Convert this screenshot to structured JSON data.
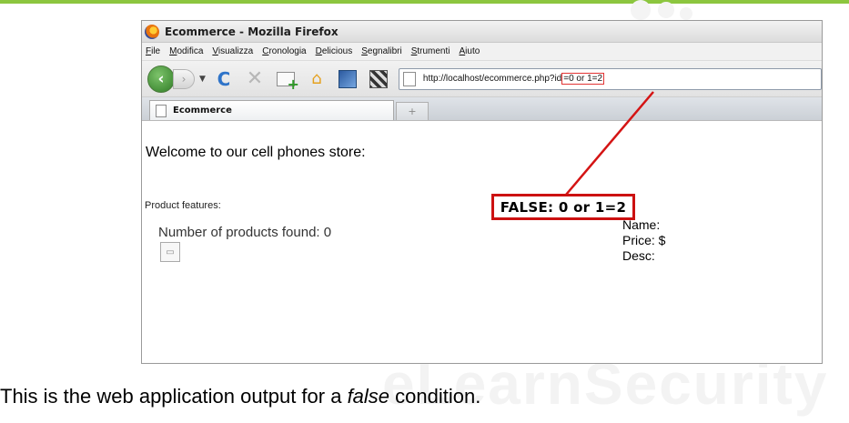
{
  "browser": {
    "title": "Ecommerce - Mozilla Firefox",
    "menu": [
      {
        "mnemonic": "F",
        "rest": "ile"
      },
      {
        "mnemonic": "M",
        "rest": "odifica"
      },
      {
        "mnemonic": "V",
        "rest": "isualizza"
      },
      {
        "mnemonic": "C",
        "rest": "ronologia"
      },
      {
        "mnemonic": "D",
        "rest": "elicious"
      },
      {
        "mnemonic": "S",
        "rest": "egnalibri"
      },
      {
        "mnemonic": "S",
        "rest": "trumenti"
      },
      {
        "mnemonic": "A",
        "rest": "iuto"
      }
    ],
    "url_prefix": "http://localhost/ecommerce.php?id",
    "url_payload": "=0 or 1=2",
    "tab_label": "Ecommerce",
    "new_tab_glyph": "+"
  },
  "page": {
    "welcome": "Welcome to our cell phones store:",
    "features_label": "Product features:",
    "products_found": "Number of products found: 0",
    "name_label": "Name:",
    "price_label": "Price: $",
    "desc_label": "Desc:"
  },
  "annotation": {
    "callout": "FALSE: 0 or 1=2",
    "color": "#cc1111"
  },
  "slide": {
    "caption_before": "This is the web application output for a ",
    "caption_emphasis": "false",
    "caption_after": " condition.",
    "watermark": "eLearnSecurity",
    "accent": "#8cc63f"
  },
  "icons": [
    "firefox-logo",
    "back-arrow-icon",
    "forward-arrow-icon",
    "reload-icon",
    "stop-icon",
    "new-tab-icon",
    "home-icon",
    "bookmark-icon",
    "page-icon",
    "broken-image-icon"
  ]
}
